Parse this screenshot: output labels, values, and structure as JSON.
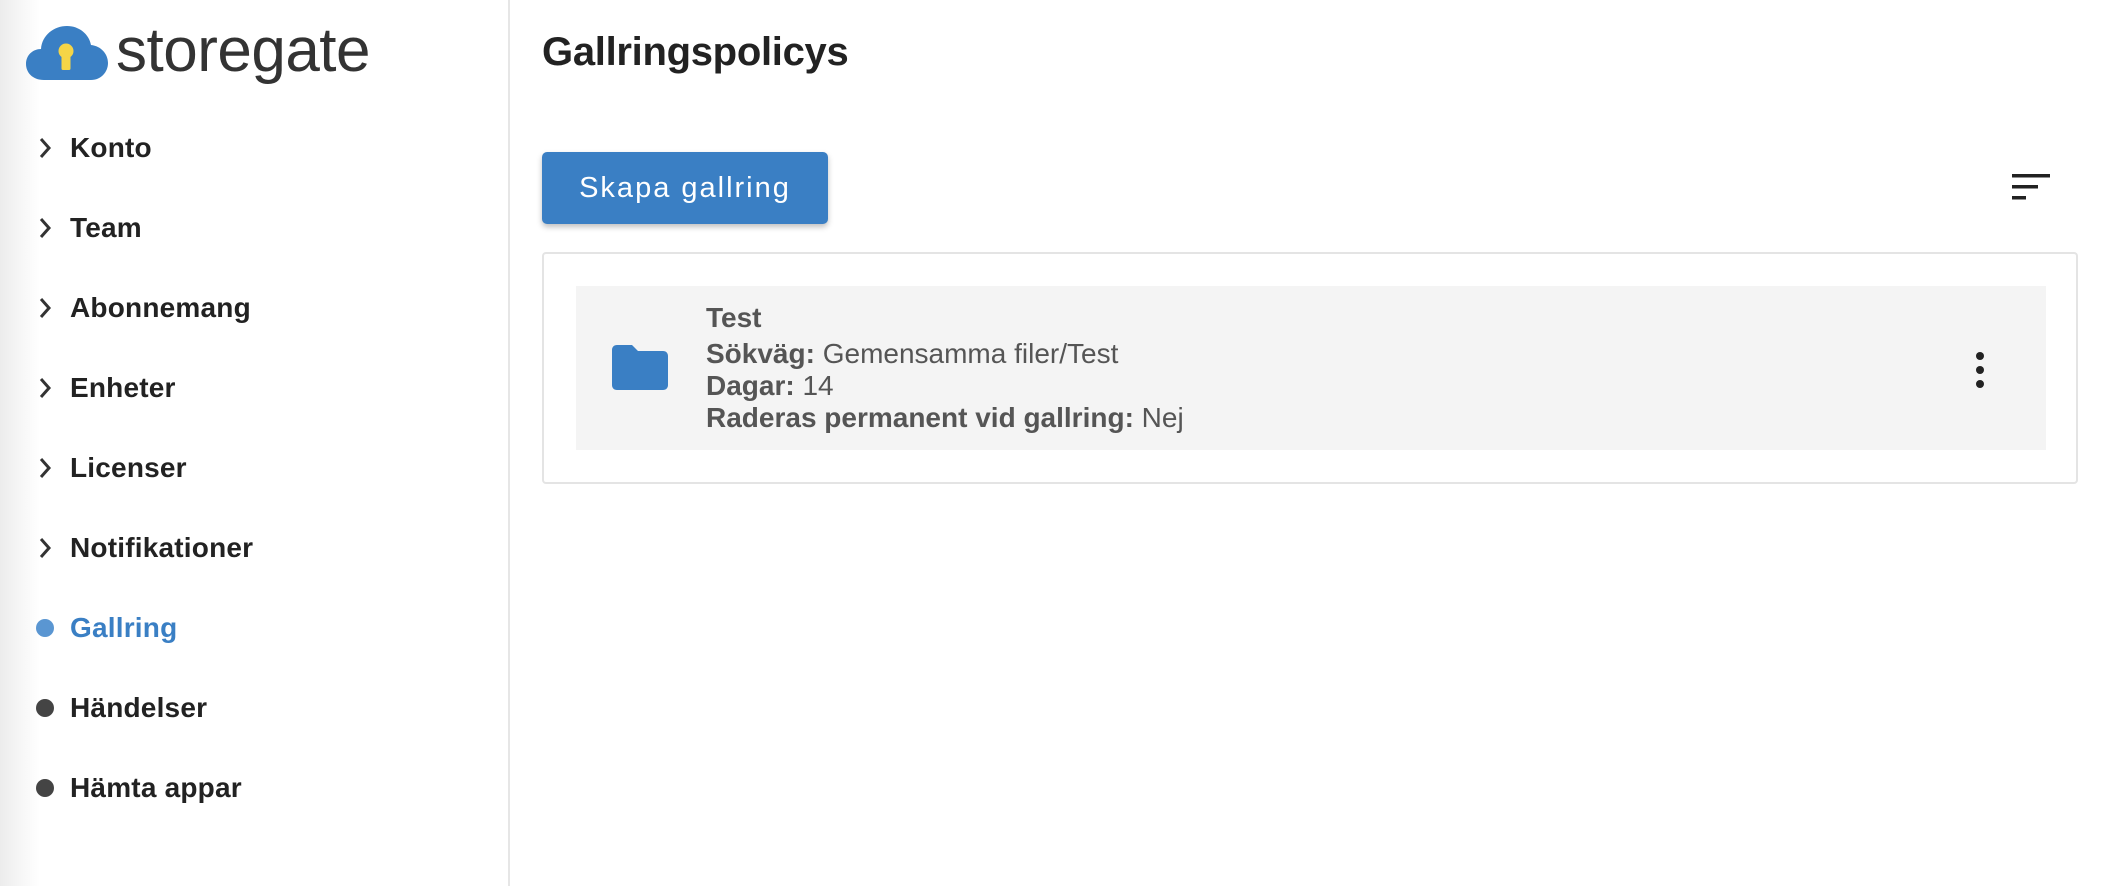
{
  "brand": {
    "name": "storegate",
    "cloud_color": "#3a7fc4",
    "keyhole_color": "#f5d547"
  },
  "sidebar": {
    "items": [
      {
        "label": "Konto",
        "icon": "chevron-right-icon",
        "active": false
      },
      {
        "label": "Team",
        "icon": "chevron-right-icon",
        "active": false
      },
      {
        "label": "Abonnemang",
        "icon": "chevron-right-icon",
        "active": false
      },
      {
        "label": "Enheter",
        "icon": "chevron-right-icon",
        "active": false
      },
      {
        "label": "Licenser",
        "icon": "chevron-right-icon",
        "active": false
      },
      {
        "label": "Notifikationer",
        "icon": "chevron-right-icon",
        "active": false
      },
      {
        "label": "Gallring",
        "icon": "dot-icon",
        "active": true
      },
      {
        "label": "Händelser",
        "icon": "dot-icon",
        "active": false
      },
      {
        "label": "Hämta appar",
        "icon": "dot-icon",
        "active": false
      }
    ]
  },
  "main": {
    "title": "Gallringspolicys",
    "create_button": "Skapa gallring",
    "sort_icon": "sort-icon",
    "policies": [
      {
        "name": "Test",
        "icon": "folder-icon",
        "path_label": "Sökväg:",
        "path_value": "Gemensamma filer/Test",
        "days_label": "Dagar:",
        "days_value": "14",
        "permanent_label": "Raderas permanent vid gallring:",
        "permanent_value": "Nej"
      }
    ]
  },
  "colors": {
    "accent": "#3a7fc4",
    "active_dot": "#5a96d2",
    "text": "#222222",
    "muted_text": "#555555"
  }
}
